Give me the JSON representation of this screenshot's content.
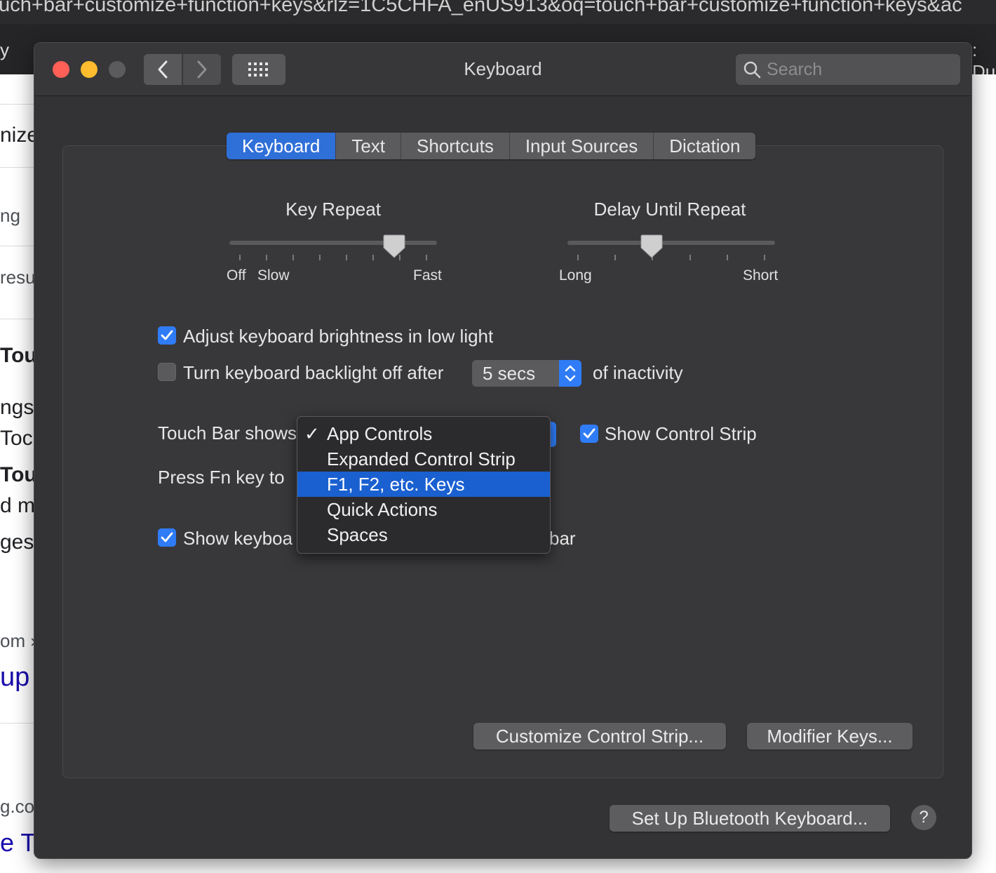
{
  "browser": {
    "url_text": "ouch+bar+customize+function+keys&rlz=1C5CHFA_enUS913&oq=touch+bar+customize+function+keys&ac",
    "tab_edge_left": "y",
    "tab_edge_right": ": Du",
    "page_fragments": [
      "nize",
      "ng",
      "resu",
      "Tou",
      "ngs/",
      "Toc",
      "Tou",
      "d m",
      "ges",
      "om ›",
      "up",
      "g.co",
      "e T"
    ]
  },
  "window": {
    "title": "Keyboard",
    "search_placeholder": "Search",
    "icons": {
      "back": "chevron-left-icon",
      "forward": "chevron-right-icon",
      "grid": "grid-icon",
      "search": "search-icon"
    }
  },
  "tabs": [
    "Keyboard",
    "Text",
    "Shortcuts",
    "Input Sources",
    "Dictation"
  ],
  "active_tab": "Keyboard",
  "key_repeat": {
    "title": "Key Repeat",
    "label_off": "Off",
    "label_slow": "Slow",
    "label_fast": "Fast",
    "level": 0.83
  },
  "delay_until_repeat": {
    "title": "Delay Until Repeat",
    "label_long": "Long",
    "label_short": "Short",
    "level": 0.4
  },
  "options": {
    "adjust_brightness": {
      "label": "Adjust keyboard brightness in low light",
      "checked": true
    },
    "backlight_off": {
      "label": "Turn keyboard backlight off after",
      "checked": false,
      "value": "5 secs",
      "suffix": "of inactivity"
    },
    "touch_bar_shows_label": "Touch Bar shows",
    "show_control_strip": {
      "label": "Show Control Strip",
      "checked": true
    },
    "press_fn_label": "Press Fn key to",
    "show_keyboard_label": "Show keyboa",
    "show_keyboard_suffix": "bar"
  },
  "touchbar_menu": {
    "items": [
      "App Controls",
      "Expanded Control Strip",
      "F1, F2, etc. Keys",
      "Quick Actions",
      "Spaces"
    ],
    "checked": "App Controls",
    "highlighted": "F1, F2, etc. Keys",
    "check_glyph": "✓"
  },
  "buttons": {
    "customize_control_strip": "Customize Control Strip...",
    "modifier_keys": "Modifier Keys...",
    "setup_bluetooth": "Set Up Bluetooth Keyboard...",
    "help": "?"
  },
  "colors": {
    "accent": "#2f7cf6",
    "highlight": "#1a60d0",
    "window_bg": "#333336"
  }
}
